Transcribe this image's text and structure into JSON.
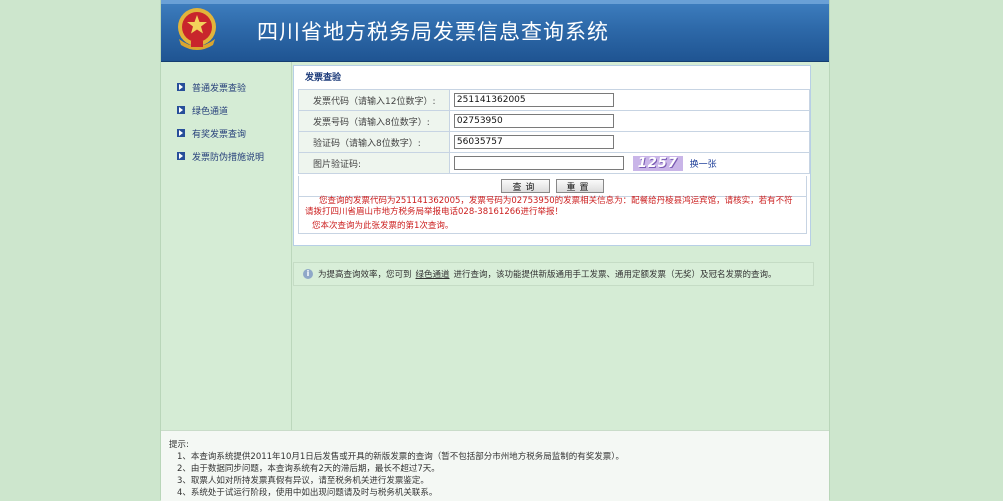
{
  "header": {
    "title": "四川省地方税务局发票信息查询系统",
    "colors": {
      "bar_top": "#3f7fc0",
      "bar_bottom": "#1f5492",
      "emblem": "#c8252c"
    }
  },
  "sidebar": {
    "items": [
      {
        "label": "普通发票查验"
      },
      {
        "label": "绿色通道"
      },
      {
        "label": "有奖发票查询"
      },
      {
        "label": "发票防伪措施说明"
      }
    ]
  },
  "form": {
    "heading": "发票查验",
    "invoice_code_label": "发票代码（请输入12位数字）:",
    "invoice_code_value": "251141362005",
    "invoice_number_label": "发票号码（请输入8位数字）:",
    "invoice_number_value": "02753950",
    "verify_code_label": "验证码（请输入8位数字）:",
    "verify_code_value": "56035757",
    "captcha_label": "图片验证码:",
    "captcha_value": "",
    "captcha_image_text": "1257",
    "captcha_refresh": "换一张",
    "query_button": "查询",
    "reset_button": "重置"
  },
  "result": {
    "message": "您查询的发票代码为251141362005，发票号码为02753950的发票相关信息为：配餐给丹棱县鸿运宾馆，请核实，若有不符请拨打四川省眉山市地方税务局举报电话028-38161266进行举报！",
    "count_text": "您本次查询为此张发票的第1次查询。",
    "color": "#cc2020"
  },
  "tip": {
    "prefix": "为提高查询效率，您可到",
    "link": "绿色通道",
    "suffix": "进行查询，该功能提供新版通用手工发票、通用定额发票（无奖）及冠名发票的查询。"
  },
  "notes": {
    "title": "提示:",
    "items": [
      "1、本查询系统提供2011年10月1日后发售或开具的新版发票的查询（暂不包括部分市州地方税务局监制的有奖发票）。",
      "2、由于数据同步问题，本查询系统有2天的滞后期，最长不超过7天。",
      "3、取票人如对所持发票真假有异议，请至税务机关进行发票鉴定。",
      "4、系统处于试运行阶段，使用中如出现问题请及时与税务机关联系。"
    ]
  }
}
